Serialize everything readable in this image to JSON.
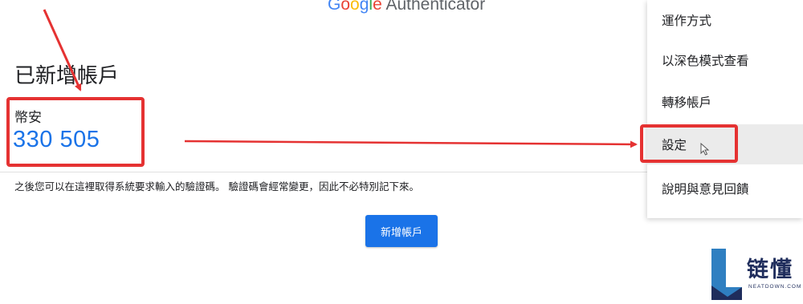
{
  "app_title": {
    "google_letters": [
      {
        "ch": "G",
        "color": "#4285F4"
      },
      {
        "ch": "o",
        "color": "#EA4335"
      },
      {
        "ch": "o",
        "color": "#FBBC05"
      },
      {
        "ch": "g",
        "color": "#4285F4"
      },
      {
        "ch": "l",
        "color": "#34A853"
      },
      {
        "ch": "e",
        "color": "#EA4335"
      }
    ],
    "suffix": "Authenticator"
  },
  "main": {
    "heading": "已新增帳戶",
    "account": {
      "name": "幣安",
      "code": "330 505"
    },
    "info_text": "之後您可以在這裡取得系統要求輸入的驗證碼。 驗證碼會經常變更，因此不必特別記下來。",
    "add_button_label": "新增帳戶"
  },
  "menu": {
    "items": [
      {
        "label": "運作方式"
      },
      {
        "label": "以深色模式查看"
      },
      {
        "label": "轉移帳戶"
      },
      {
        "label": "設定"
      },
      {
        "label": "說明與意見回饋"
      }
    ],
    "hovered_item": "設定"
  },
  "watermark": {
    "brand": "链懂",
    "site": "NEATDOWN.COM"
  },
  "colors": {
    "accent_blue": "#1a73e8",
    "highlight_red": "#e53232",
    "code_blue": "#1a73e8"
  }
}
